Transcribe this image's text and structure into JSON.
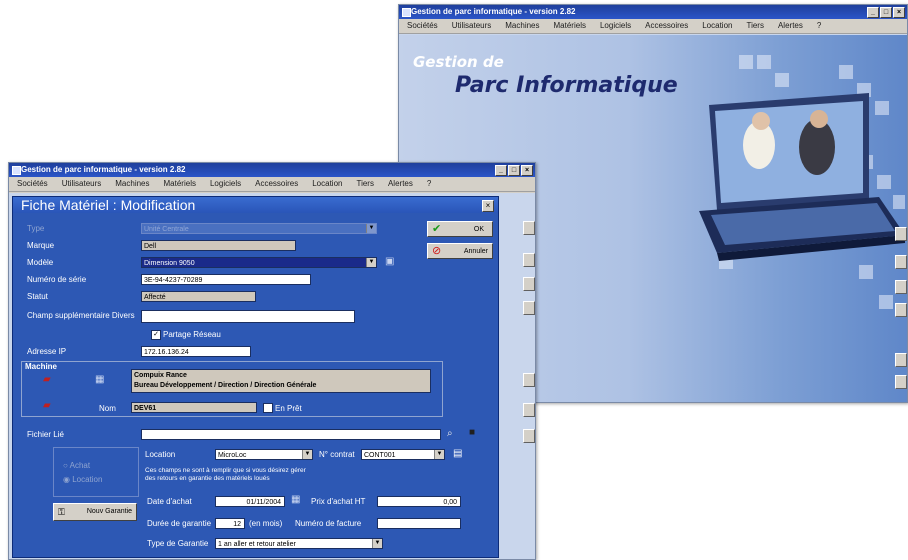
{
  "back_window": {
    "title": "Gestion de parc informatique - version 2.82",
    "controls": [
      "_",
      "□",
      "×"
    ],
    "menu": [
      "Sociétés",
      "Utilisateurs",
      "Machines",
      "Matériels",
      "Logiciels",
      "Accessoires",
      "Location",
      "Tiers",
      "Alertes",
      "?"
    ],
    "brand_line1": "Gestion de",
    "brand_line2": "Parc Informatique"
  },
  "front_window": {
    "title": "Gestion de parc informatique - version 2.82",
    "controls": [
      "_",
      "□",
      "×"
    ],
    "menu": [
      "Sociétés",
      "Utilisateurs",
      "Machines",
      "Matériels",
      "Logiciels",
      "Accessoires",
      "Location",
      "Tiers",
      "Alertes",
      "?"
    ]
  },
  "dialog": {
    "title": "Fiche Matériel : Modification",
    "close": "×",
    "ok_label": "OK",
    "cancel_label": "Annuler",
    "fields": {
      "type": {
        "label": "Type",
        "value": "Unité Centrale"
      },
      "marque": {
        "label": "Marque",
        "value": "Dell"
      },
      "modele": {
        "label": "Modèle",
        "value": "Dimension 9050"
      },
      "serie": {
        "label": "Numéro de série",
        "value": "3E-94-4237-70289"
      },
      "statut": {
        "label": "Statut",
        "value": "Affecté"
      },
      "champ": {
        "label": "Champ supplémentaire Divers",
        "value": ""
      },
      "partage_label": "Partage Réseau",
      "ip": {
        "label": "Adresse IP",
        "value": "172.16.136.24"
      }
    },
    "machine": {
      "header": "Machine",
      "line1": "Compuix  Rance",
      "line2": "Bureau Développement / Direction / Direction Générale",
      "nom_label": "Nom",
      "nom_value": "DEV61",
      "en_pret_label": "En Prêt"
    },
    "fichier": {
      "label": "Fichier Lié",
      "value": ""
    },
    "options": {
      "location_label": "Location",
      "location_value": "MicroLoc",
      "contrat_label": "N° contrat",
      "contrat_value": "CONT001",
      "note": "Ces champs ne sont à remplir que si vous désirez gérer des retours en garantie des matériels loués",
      "type_achat": "Achat",
      "type_location": "Location",
      "nouveau_label": "Nouv Garantie"
    },
    "achat": {
      "date_label": "Date d'achat",
      "date_value": "01/11/2004",
      "prix_label": "Prix d'achat HT",
      "prix_value": "0,00",
      "duree_label": "Durée de garantie",
      "duree_value": "12",
      "duree_unit": "(en mois)",
      "facture_label": "Numéro de facture",
      "facture_value": "",
      "type_gar_label": "Type de Garantie",
      "type_gar_value": "1 an aller et retour atelier"
    }
  },
  "colors": {
    "dialog_bg": "#2d58b4",
    "titlebar": "#2b55c8",
    "chrome": "#d4d0c8"
  },
  "icons": [
    "check-icon",
    "no-entry-icon",
    "network-card-icon",
    "computer-icon",
    "search-icon",
    "folder-icon"
  ]
}
